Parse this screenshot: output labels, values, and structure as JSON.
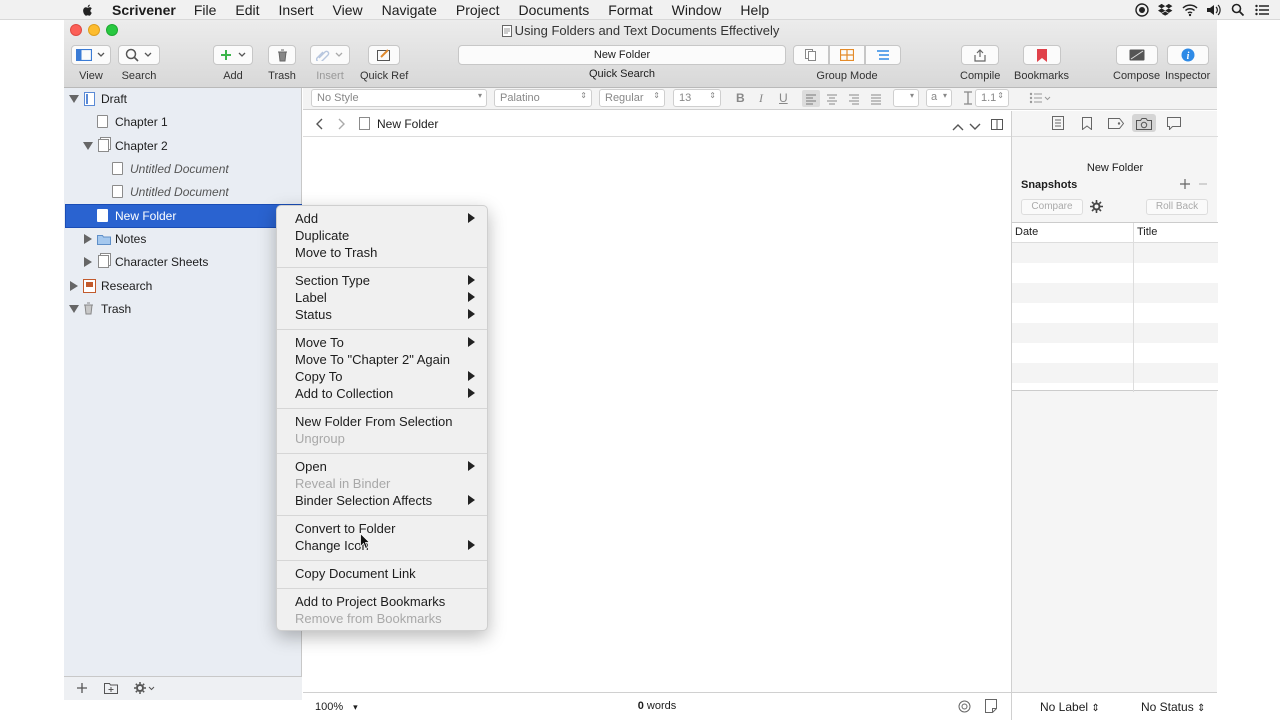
{
  "menubar": {
    "app_name": "Scrivener",
    "items": [
      "File",
      "Edit",
      "Insert",
      "View",
      "Navigate",
      "Project",
      "Documents",
      "Format",
      "Window",
      "Help"
    ]
  },
  "window": {
    "title": "Using Folders and Text Documents Effectively"
  },
  "toolbar": {
    "view_label": "View",
    "search_label": "Search",
    "add_label": "Add",
    "trash_label": "Trash",
    "insert_label": "Insert",
    "quickref_label": "Quick Ref",
    "quick_search_value": "New Folder",
    "quick_search_label": "Quick Search",
    "group_mode_label": "Group Mode",
    "compile_label": "Compile",
    "bookmarks_label": "Bookmarks",
    "compose_label": "Compose",
    "inspector_label": "Inspector"
  },
  "binder": {
    "items": [
      {
        "label": "Draft"
      },
      {
        "label": "Chapter 1"
      },
      {
        "label": "Chapter 2"
      },
      {
        "label": "Untitled Document"
      },
      {
        "label": "Untitled Document"
      },
      {
        "label": "New Folder"
      },
      {
        "label": "Notes"
      },
      {
        "label": "Character Sheets"
      },
      {
        "label": "Research"
      },
      {
        "label": "Trash"
      }
    ]
  },
  "formatbar": {
    "style": "No Style",
    "font": "Palatino",
    "weight": "Regular",
    "size": "13",
    "line_spacing": "1.1",
    "bold": "B",
    "italic": "I",
    "underline": "U"
  },
  "editor": {
    "doc_title": "New Folder",
    "zoom": "100%",
    "word_count_num": "0",
    "word_count_label": "words"
  },
  "inspector": {
    "doc_title": "New Folder",
    "section_title": "Snapshots",
    "compare_label": "Compare",
    "rollback_label": "Roll Back",
    "col_date": "Date",
    "col_title": "Title",
    "label_value": "No Label",
    "status_value": "No Status"
  },
  "context_menu": {
    "add": "Add",
    "duplicate": "Duplicate",
    "move_to_trash": "Move to Trash",
    "section_type": "Section Type",
    "label": "Label",
    "status": "Status",
    "move_to": "Move To",
    "move_to_again": "Move To \"Chapter 2\" Again",
    "copy_to": "Copy To",
    "add_to_collection": "Add to Collection",
    "new_folder_from_selection": "New Folder From Selection",
    "ungroup": "Ungroup",
    "open": "Open",
    "reveal_in_binder": "Reveal in Binder",
    "binder_selection_affects": "Binder Selection Affects",
    "convert_to_folder": "Convert to Folder",
    "change_icon": "Change Icon",
    "copy_document_link": "Copy Document Link",
    "add_to_project_bookmarks": "Add to Project Bookmarks",
    "remove_from_bookmarks": "Remove from Bookmarks"
  },
  "colors": {
    "selection": "#2a63d0",
    "binder_bg": "#e9edf3",
    "bookmark_red": "#e0414a",
    "inspector_blue": "#2e8ae6"
  }
}
